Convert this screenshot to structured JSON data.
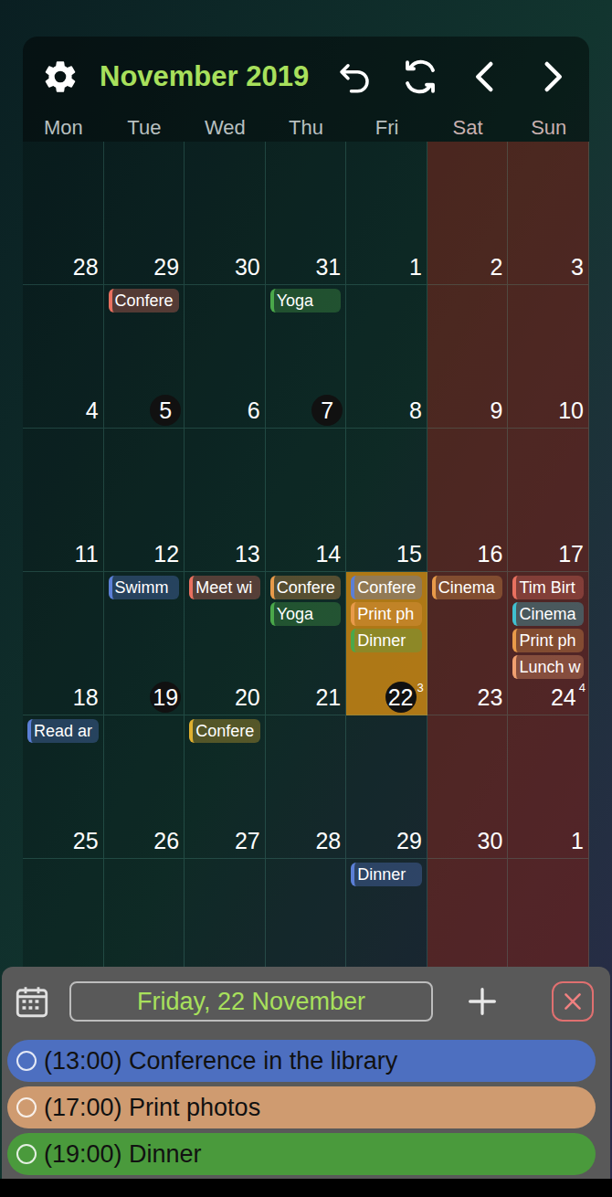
{
  "header": {
    "title": "November 2019"
  },
  "weekdays": [
    {
      "label": "Mon",
      "weekend": false
    },
    {
      "label": "Tue",
      "weekend": false
    },
    {
      "label": "Wed",
      "weekend": false
    },
    {
      "label": "Thu",
      "weekend": false
    },
    {
      "label": "Fri",
      "weekend": false
    },
    {
      "label": "Sat",
      "weekend": true
    },
    {
      "label": "Sun",
      "weekend": true
    }
  ],
  "weeks": [
    {
      "days": [
        {
          "number": "28",
          "circled": false,
          "selected": false,
          "events": []
        },
        {
          "number": "29",
          "circled": false,
          "selected": false,
          "events": []
        },
        {
          "number": "30",
          "circled": false,
          "selected": false,
          "events": []
        },
        {
          "number": "31",
          "circled": false,
          "selected": false,
          "events": []
        },
        {
          "number": "1",
          "circled": false,
          "selected": false,
          "events": []
        },
        {
          "number": "2",
          "circled": false,
          "selected": false,
          "events": []
        },
        {
          "number": "3",
          "circled": false,
          "selected": false,
          "events": []
        }
      ]
    },
    {
      "days": [
        {
          "number": "4",
          "circled": false,
          "selected": false,
          "events": []
        },
        {
          "number": "5",
          "circled": true,
          "selected": false,
          "events": [
            {
              "title": "Confere",
              "color": "#e8705f"
            }
          ]
        },
        {
          "number": "6",
          "circled": false,
          "selected": false,
          "events": []
        },
        {
          "number": "7",
          "circled": true,
          "selected": false,
          "events": [
            {
              "title": "Yoga",
              "color": "#4aa84a"
            }
          ]
        },
        {
          "number": "8",
          "circled": false,
          "selected": false,
          "events": []
        },
        {
          "number": "9",
          "circled": false,
          "selected": false,
          "events": []
        },
        {
          "number": "10",
          "circled": false,
          "selected": false,
          "events": []
        }
      ]
    },
    {
      "days": [
        {
          "number": "11",
          "circled": false,
          "selected": false,
          "events": []
        },
        {
          "number": "12",
          "circled": false,
          "selected": false,
          "events": []
        },
        {
          "number": "13",
          "circled": false,
          "selected": false,
          "events": []
        },
        {
          "number": "14",
          "circled": false,
          "selected": false,
          "events": []
        },
        {
          "number": "15",
          "circled": false,
          "selected": false,
          "events": []
        },
        {
          "number": "16",
          "circled": false,
          "selected": false,
          "events": []
        },
        {
          "number": "17",
          "circled": false,
          "selected": false,
          "events": []
        }
      ]
    },
    {
      "days": [
        {
          "number": "18",
          "circled": false,
          "selected": false,
          "events": []
        },
        {
          "number": "19",
          "circled": true,
          "selected": false,
          "events": [
            {
              "title": "Swimm",
              "color": "#5b7fd6"
            }
          ]
        },
        {
          "number": "20",
          "circled": false,
          "selected": false,
          "events": [
            {
              "title": "Meet wi",
              "color": "#e8705f"
            }
          ]
        },
        {
          "number": "21",
          "circled": false,
          "selected": false,
          "events": [
            {
              "title": "Confere",
              "color": "#e89a4a"
            },
            {
              "title": "Yoga",
              "color": "#4aa84a"
            }
          ]
        },
        {
          "number": "22",
          "circled": true,
          "selected": true,
          "badge": "3",
          "events": [
            {
              "title": "Confere",
              "color": "#5b7fd6"
            },
            {
              "title": "Print ph",
              "color": "#e89a4a"
            },
            {
              "title": "Dinner",
              "color": "#4aa84a"
            }
          ]
        },
        {
          "number": "23",
          "circled": false,
          "selected": false,
          "events": [
            {
              "title": "Cinema",
              "color": "#e89a4a"
            }
          ]
        },
        {
          "number": "24",
          "circled": false,
          "selected": false,
          "badge": "4",
          "events": [
            {
              "title": "Tim Birt",
              "color": "#e8705f"
            },
            {
              "title": "Cinema",
              "color": "#40c0d0"
            },
            {
              "title": "Print ph",
              "color": "#e89a4a"
            },
            {
              "title": "Lunch w",
              "color": "#f0a070"
            }
          ]
        }
      ]
    },
    {
      "days": [
        {
          "number": "25",
          "circled": false,
          "selected": false,
          "events": [
            {
              "title": "Read ar",
              "color": "#5b7fd6"
            }
          ]
        },
        {
          "number": "26",
          "circled": false,
          "selected": false,
          "events": []
        },
        {
          "number": "27",
          "circled": false,
          "selected": false,
          "events": [
            {
              "title": "Confere",
              "color": "#e0b030"
            }
          ]
        },
        {
          "number": "28",
          "circled": false,
          "selected": false,
          "events": []
        },
        {
          "number": "29",
          "circled": false,
          "selected": false,
          "events": []
        },
        {
          "number": "30",
          "circled": false,
          "selected": false,
          "events": []
        },
        {
          "number": "1",
          "circled": false,
          "selected": false,
          "events": []
        }
      ]
    },
    {
      "days": [
        {
          "circled": false,
          "selected": false,
          "events": []
        },
        {
          "circled": false,
          "selected": false,
          "events": []
        },
        {
          "circled": false,
          "selected": false,
          "events": []
        },
        {
          "circled": false,
          "selected": false,
          "events": []
        },
        {
          "circled": false,
          "selected": false,
          "events": [
            {
              "title": "Dinner",
              "color": "#5b7fd6"
            }
          ]
        },
        {
          "circled": false,
          "selected": false,
          "events": []
        },
        {
          "circled": false,
          "selected": false,
          "events": []
        }
      ]
    }
  ],
  "selected_day": {
    "label": "Friday, 22 November"
  },
  "agenda": [
    {
      "text": "(13:00) Conference in the library",
      "color": "#4d6fc0"
    },
    {
      "text": "(17:00) Print photos",
      "color": "#cf9b70"
    },
    {
      "text": "(19:00) Dinner",
      "color": "#4a9a3c"
    }
  ]
}
